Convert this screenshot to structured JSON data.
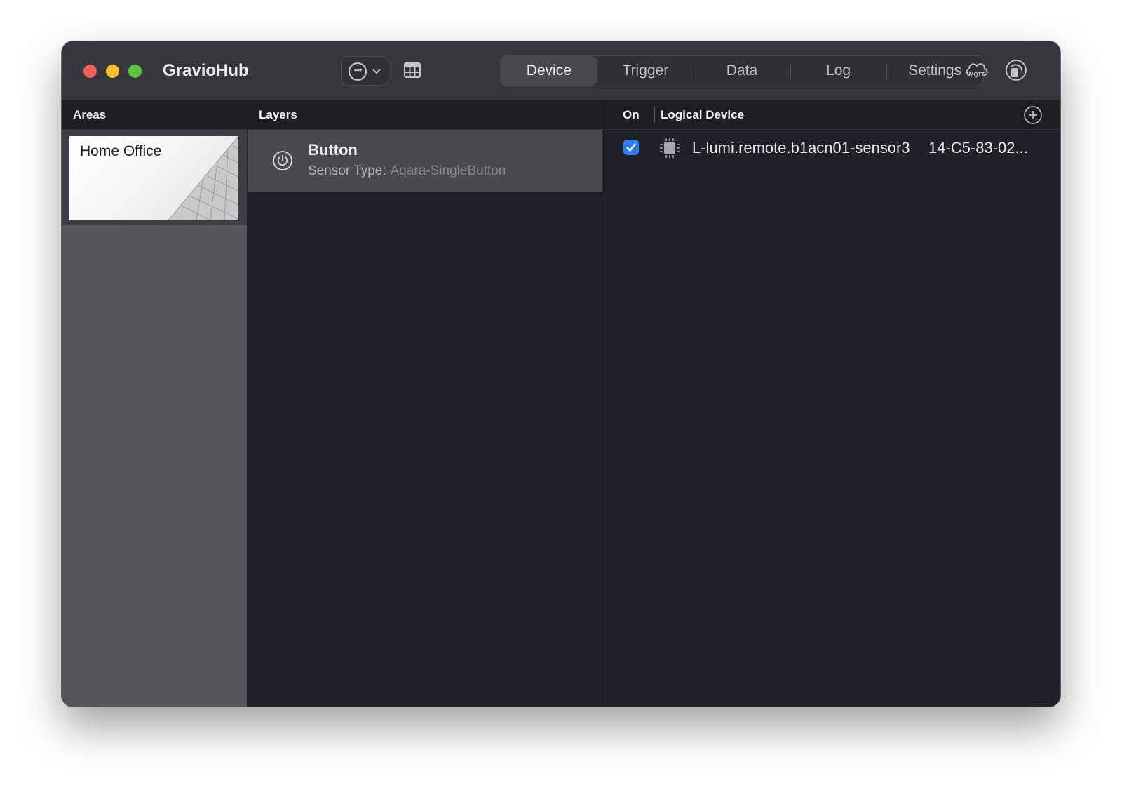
{
  "window": {
    "app_title": "GravioHub"
  },
  "toolbar": {
    "more_icon": "ellipsis-circle-icon",
    "grid_icon": "table-grid-icon",
    "tabs": [
      {
        "label": "Device",
        "active": true
      },
      {
        "label": "Trigger",
        "active": false
      },
      {
        "label": "Data",
        "active": false
      },
      {
        "label": "Log",
        "active": false
      },
      {
        "label": "Settings",
        "active": false
      }
    ],
    "mqtt_icon_label": "MQTT"
  },
  "areas": {
    "header": "Areas",
    "items": [
      {
        "name": "Home Office",
        "selected": true
      }
    ]
  },
  "layers": {
    "header": "Layers",
    "items": [
      {
        "name": "Button",
        "sensor_type_label": "Sensor Type:",
        "sensor_type": "Aqara-SingleButton",
        "selected": true
      }
    ]
  },
  "devices": {
    "col_on": "On",
    "col_logical": "Logical Device",
    "items": [
      {
        "enabled": true,
        "name": "L-lumi.remote.b1acn01-sensor3",
        "mac": "14-C5-83-02..."
      }
    ]
  },
  "colors": {
    "accent": "#2f7cf6",
    "close": "#ee5f57",
    "minimize": "#f5bd2f",
    "zoom": "#5fc53f"
  }
}
